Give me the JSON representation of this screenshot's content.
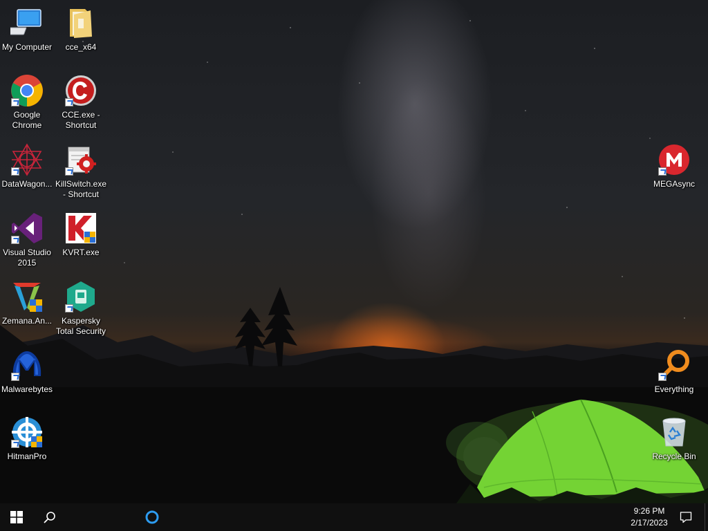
{
  "desktop": {
    "icons": [
      {
        "label": "My Computer",
        "icon": "computer-icon"
      },
      {
        "label": "cce_x64",
        "icon": "folder-icon"
      },
      {
        "label": "Google Chrome",
        "icon": "chrome-icon"
      },
      {
        "label": "CCE.exe - Shortcut",
        "icon": "cce-icon"
      },
      {
        "label": "DataWagon...",
        "icon": "datawagon-icon"
      },
      {
        "label": "KillSwitch.exe - Shortcut",
        "icon": "killswitch-icon"
      },
      {
        "label": "Visual Studio 2015",
        "icon": "visual-studio-icon"
      },
      {
        "label": "KVRT.exe",
        "icon": "kvrt-icon"
      },
      {
        "label": "Zemana.An...",
        "icon": "zemana-icon"
      },
      {
        "label": "Kaspersky Total Security",
        "icon": "kaspersky-icon"
      },
      {
        "label": "Malwarebytes",
        "icon": "malwarebytes-icon"
      },
      {
        "label": "HitmanPro",
        "icon": "hitmanpro-icon"
      },
      {
        "label": "MEGAsync",
        "icon": "mega-icon"
      },
      {
        "label": "Everything",
        "icon": "everything-icon"
      },
      {
        "label": "Recycle Bin",
        "icon": "recycle-bin-icon"
      }
    ]
  },
  "taskbar": {
    "start_icon": "windows-logo-icon",
    "search_icon": "search-icon",
    "cortana_icon": "cortana-icon",
    "clock": {
      "time": "9:26 PM",
      "date": "2/17/2023"
    },
    "notifications_icon": "action-center-icon"
  },
  "colors": {
    "taskbar": "#101010",
    "cortana": "#2d9cf0",
    "tent": "#7fe03a"
  }
}
